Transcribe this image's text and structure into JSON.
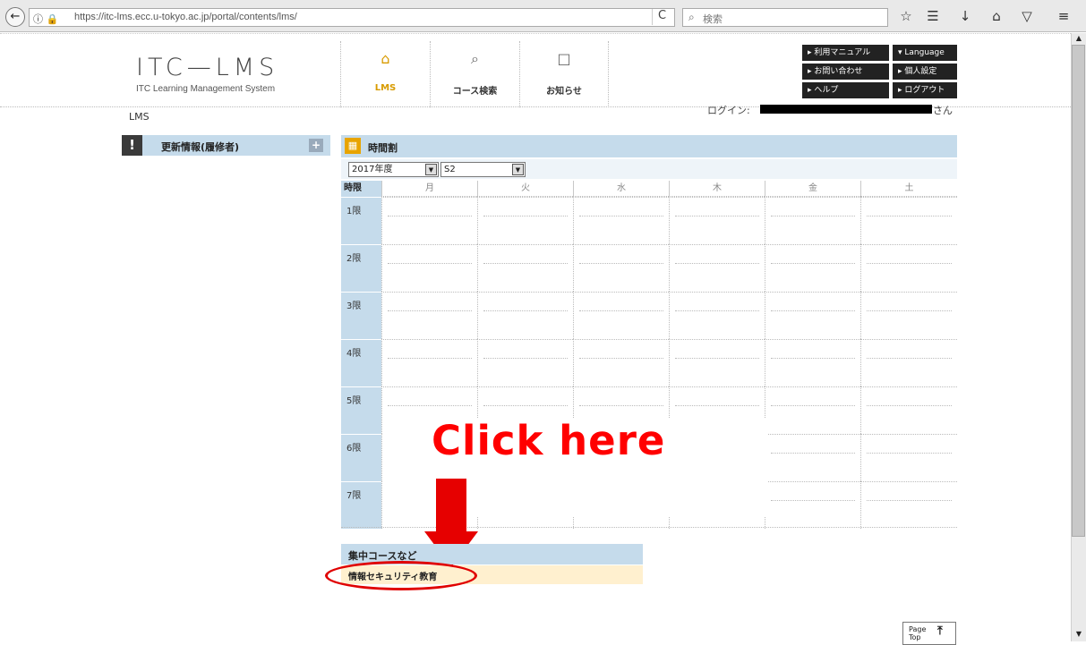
{
  "browser": {
    "url": "https://itc-lms.ecc.u-tokyo.ac.jp/portal/contents/lms/",
    "search_placeholder": "検索",
    "back_glyph": "←",
    "reload_glyph": "C",
    "url_icons": "ⓘ 🔒",
    "search_glyph": "⌕",
    "toolbar_icons": [
      "star-icon",
      "reading-list-icon",
      "download-icon",
      "home-icon",
      "pocket-icon",
      "menu-icon"
    ],
    "toolbar_glyphs": [
      "☆",
      "☰",
      "↓",
      "⌂",
      "▽",
      "≡"
    ]
  },
  "header": {
    "logo_title": "ITC—LMS",
    "logo_subtitle": "ITC Learning Management System",
    "nav": [
      {
        "label": "LMS",
        "icon": "graduation-cap-icon",
        "glyph": "⌂"
      },
      {
        "label": "コース検索",
        "icon": "search-icon",
        "glyph": "⌕"
      },
      {
        "label": "お知らせ",
        "icon": "speech-bubble-icon",
        "glyph": "□"
      }
    ],
    "links": {
      "manual": "▸ 利用マニュアル",
      "language": "▾ Language",
      "contact": "▸ お問い合わせ",
      "personal": "▸ 個人設定",
      "help": "▸ ヘルプ",
      "logout": "▸ ログアウト"
    },
    "login_label": "ログイン:",
    "login_suffix": "さん"
  },
  "breadcrumb": "LMS",
  "updates_panel": {
    "title": "更新情報(履修者)",
    "icon_glyph": "!",
    "plus_glyph": "+"
  },
  "timetable": {
    "title": "時間割",
    "icon_glyph": "▦",
    "year": "2017年度",
    "term": "S2",
    "corner": "時限",
    "days": [
      "月",
      "火",
      "水",
      "木",
      "金",
      "土"
    ],
    "periods": [
      "1限",
      "2限",
      "3限",
      "4限",
      "5限",
      "6限",
      "7限"
    ]
  },
  "intensive": {
    "title": "集中コースなど",
    "course": "情報セキュリティ教育"
  },
  "annotation": {
    "text": "Click here",
    "color": "#ff0000"
  },
  "page_top": {
    "line1": "Page",
    "line2": "Top",
    "glyph": "⤒"
  },
  "scroll": {
    "up": "▲",
    "down": "▼"
  },
  "colors": {
    "panel_blue": "#c5dbeb",
    "accent_orange": "#e8a400",
    "course_row": "#fff0cf"
  }
}
